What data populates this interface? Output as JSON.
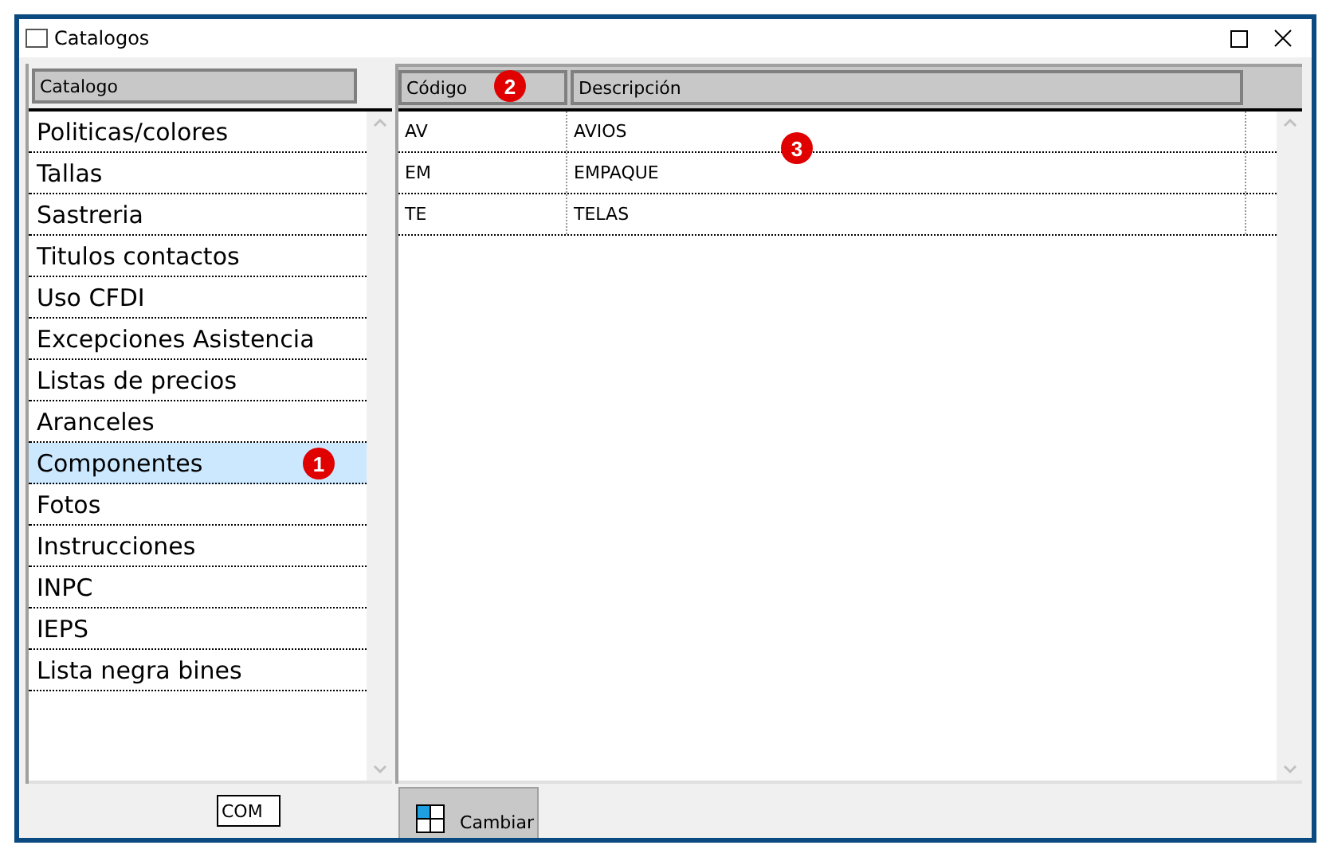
{
  "window": {
    "title": "Catalogos"
  },
  "catalog": {
    "header": "Catalogo",
    "items": [
      {
        "label": "Politicas/colores",
        "selected": false
      },
      {
        "label": "Tallas",
        "selected": false
      },
      {
        "label": "Sastreria",
        "selected": false
      },
      {
        "label": "Titulos contactos",
        "selected": false
      },
      {
        "label": "Uso CFDI",
        "selected": false
      },
      {
        "label": "Excepciones Asistencia",
        "selected": false
      },
      {
        "label": "Listas de precios",
        "selected": false
      },
      {
        "label": "Aranceles",
        "selected": false
      },
      {
        "label": "Componentes",
        "selected": true,
        "marker": "1"
      },
      {
        "label": "Fotos",
        "selected": false
      },
      {
        "label": "Instrucciones",
        "selected": false
      },
      {
        "label": "INPC",
        "selected": false
      },
      {
        "label": "IEPS",
        "selected": false
      },
      {
        "label": "Lista negra bines",
        "selected": false
      }
    ]
  },
  "table": {
    "columns": [
      {
        "label": "Código",
        "marker": "2"
      },
      {
        "label": "Descripción"
      }
    ],
    "rows": [
      {
        "cells": [
          "AV",
          "AVIOS"
        ],
        "marker": "3"
      },
      {
        "cells": [
          "EM",
          "EMPAQUE"
        ]
      },
      {
        "cells": [
          "TE",
          "TELAS"
        ]
      }
    ]
  },
  "footer": {
    "code_field": "COM",
    "button": "Cambiar"
  }
}
